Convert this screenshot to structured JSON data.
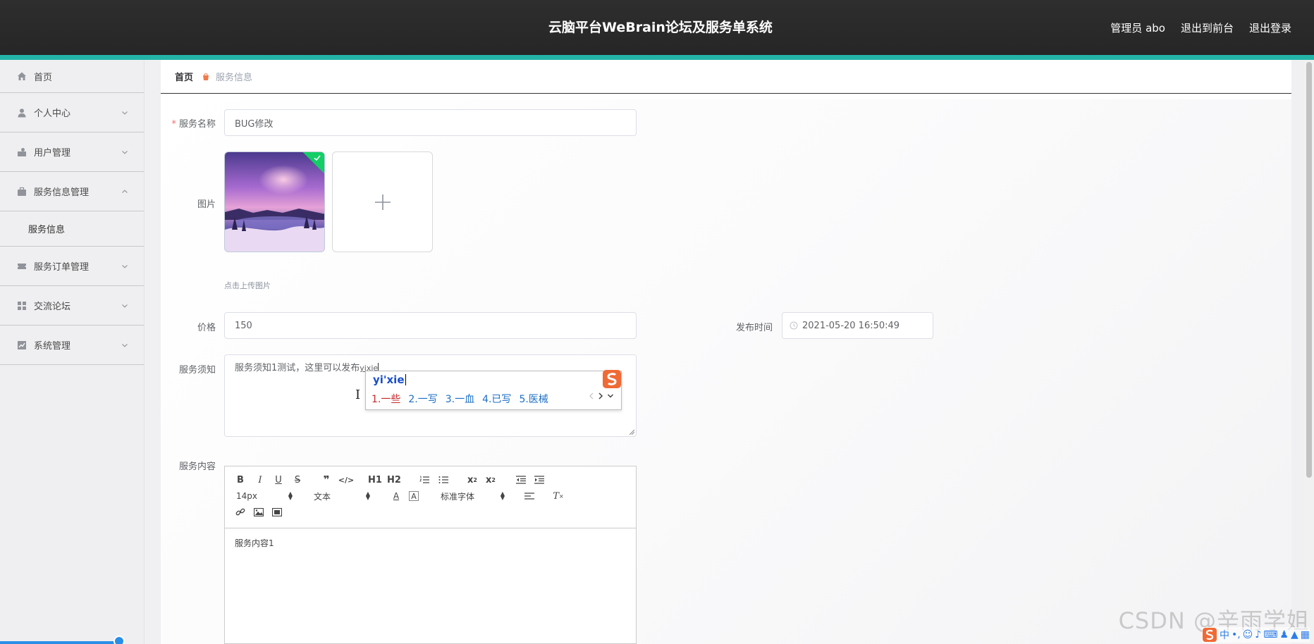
{
  "header": {
    "title": "云脑平台WeBrain论坛及服务单系统",
    "admin_label": "管理员 abo",
    "back_front": "退出到前台",
    "logout": "退出登录"
  },
  "sidebar": {
    "items": [
      {
        "label": "首页",
        "icon": "home-icon"
      },
      {
        "label": "个人中心",
        "icon": "user-icon"
      },
      {
        "label": "用户管理",
        "icon": "user-manage-icon"
      },
      {
        "label": "服务信息管理",
        "icon": "briefcase-icon"
      },
      {
        "label": "服务订单管理",
        "icon": "ticket-icon"
      },
      {
        "label": "交流论坛",
        "icon": "grid-icon"
      },
      {
        "label": "系统管理",
        "icon": "chart-icon"
      }
    ],
    "sub_items": [
      {
        "label": "服务信息"
      }
    ]
  },
  "breadcrumb": {
    "home": "首页",
    "current": "服务信息"
  },
  "form": {
    "name_label": "服务名称",
    "name_value": "BUG修改",
    "image_label": "图片",
    "upload_hint": "点击上传图片",
    "price_label": "价格",
    "price_value": "150",
    "publish_time_label": "发布时间",
    "publish_time_value": "2021-05-20 16:50:49",
    "notice_label": "服务须知",
    "notice_value": "服务须知1测试，这里可以发布",
    "notice_composing": "yixie",
    "content_label": "服务内容",
    "content_value": "服务内容1"
  },
  "ime": {
    "composition": "yi'xie",
    "candidates": [
      "1.一些",
      "2.一写",
      "3.一血",
      "4.已写",
      "5.医械"
    ]
  },
  "editor": {
    "font_size": "14px",
    "paragraph": "文本",
    "font_family": "标准字体",
    "h1": "H1",
    "h2": "H2"
  },
  "ime_status": {
    "mode": "中"
  },
  "watermark": "CSDN @辛雨学姐",
  "colors": {
    "header_bg": "#2b2b2b",
    "accent": "#24b3a7",
    "success": "#13ce66",
    "required": "#f56c6c"
  }
}
